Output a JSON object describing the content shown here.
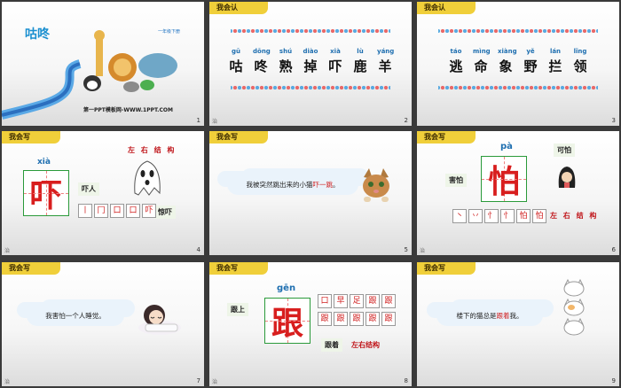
{
  "slides": [
    {
      "num": "1",
      "title": "咕咚",
      "subtitle": "一年级下册",
      "footer": "第一PPT模板网-WWW.1PPT.COM"
    },
    {
      "num": "2",
      "header": "我会认",
      "pinyin": [
        "gū",
        "dōng",
        "shú",
        "diào",
        "xià",
        "lù",
        "yáng"
      ],
      "chars": [
        "咕",
        "咚",
        "熟",
        "掉",
        "吓",
        "鹿",
        "羊"
      ]
    },
    {
      "num": "3",
      "header": "我会认",
      "pinyin": [
        "táo",
        "mìng",
        "xiàng",
        "yě",
        "lán",
        "lǐng"
      ],
      "chars": [
        "逃",
        "命",
        "象",
        "野",
        "拦",
        "领"
      ]
    },
    {
      "num": "4",
      "header": "我会写",
      "pinyin": "xià",
      "char": "吓",
      "structure": "左 右 结 构",
      "words": [
        "吓人",
        "惊吓"
      ],
      "strokes": [
        "丨",
        "冂",
        "口",
        "口",
        "吓",
        "吓"
      ]
    },
    {
      "num": "5",
      "header": "我会写",
      "sentence_pre": "我被突然跳出来的小猫",
      "sentence_hl": "吓一跳",
      "sentence_post": "。"
    },
    {
      "num": "6",
      "header": "我会写",
      "pinyin": "pà",
      "char": "怕",
      "structure": "左 右 结 构",
      "words": [
        "害怕",
        "可怕"
      ],
      "strokes": [
        "丶",
        "丷",
        "忄",
        "忄",
        "怕",
        "怕",
        "怕",
        "怕"
      ]
    },
    {
      "num": "7",
      "header": "我会写",
      "sentence_pre": "我",
      "sentence_hl": "害怕",
      "sentence_post": "一个人睡觉。"
    },
    {
      "num": "8",
      "header": "我会写",
      "pinyin": "gēn",
      "char": "跟",
      "structure": "左右结构",
      "words": [
        "跟上",
        "跟着"
      ],
      "strokes": [
        "口",
        "早",
        "足",
        "跟",
        "跟",
        "跟",
        "跟",
        "跟",
        "跟",
        "跟",
        "跟",
        "跟",
        "跟"
      ]
    },
    {
      "num": "9",
      "header": "我会写",
      "sentence_pre": "楼下的猫总是",
      "sentence_hl": "跟着",
      "sentence_post": "我。"
    }
  ],
  "corner_mark": "治"
}
